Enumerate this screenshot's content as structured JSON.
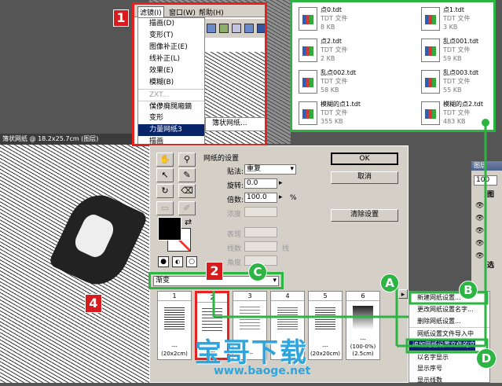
{
  "badges": {
    "one": "1",
    "two": "2",
    "four": "4",
    "a": "A",
    "b": "B",
    "c": "C",
    "d": "D"
  },
  "menubar": {
    "filter": "滤镜(I)",
    "window": "窗口(W)",
    "help": "帮助(H)"
  },
  "filter_menu": {
    "items": [
      "描画(D)",
      "变形(T)",
      "图像补正(E)",
      "线补正(L)",
      "效果(E)",
      "模糊(B)",
      "ZXT...",
      "僕儚廃闊廂鏑",
      "变形",
      "力量网纸3",
      "描画"
    ],
    "submenu": "簿状网纸..."
  },
  "files": [
    {
      "name": "点0.tdt",
      "type": "TDT 文件",
      "size": "8 KB"
    },
    {
      "name": "点1.tdt",
      "type": "TDT 文件",
      "size": "3 KB"
    },
    {
      "name": "点2.tdt",
      "type": "TDT 文件",
      "size": "2 KB"
    },
    {
      "name": "乱点001.tdt",
      "type": "TDT 文件",
      "size": "59 KB"
    },
    {
      "name": "乱点002.tdt",
      "type": "TDT 文件",
      "size": "58 KB"
    },
    {
      "name": "乱点003.tdt",
      "type": "TDT 文件",
      "size": "55 KB"
    },
    {
      "name": "模糊的点1.tdt",
      "type": "TDT 文件",
      "size": "355 KB"
    },
    {
      "name": "模糊的点2.tdt",
      "type": "TDT 文件",
      "size": "483 KB"
    }
  ],
  "doc_title": "簿状网纸 @ 18.2x25.7cm (图层)",
  "dialog": {
    "group_title": "网纸的设置",
    "paste_label": "贴法:",
    "paste_value": "重复",
    "rotate_label": "旋转:",
    "rotate_value": "0.0",
    "scale_label": "倍数:",
    "scale_value": "100.0",
    "scale_unit": "%",
    "density_label": "浓度",
    "expr_label": "表现",
    "lines_label": "线数",
    "lines_unit": "线",
    "angle_label": "角度",
    "ok": "OK",
    "cancel": "取消",
    "clear": "清除设置",
    "preset_value": "渐变",
    "swatch_numbers": [
      "1",
      "2",
      "3",
      "4",
      "5",
      "6"
    ],
    "swatch_labels": [
      "---",
      "---",
      "---",
      "---",
      "---",
      "---"
    ],
    "swatch_sub": [
      "(20x2cm)",
      "",
      "",
      "",
      "(20x20cm)",
      "(100-0%)"
    ],
    "swatch_sub2": [
      "",
      "",
      "",
      "",
      "",
      "(2.5cm)"
    ]
  },
  "context_menu": {
    "items": [
      "新建网纸设置...",
      "更改网纸设置名字...",
      "删除网纸设置...",
      "网纸设置文件导入中",
      "追加网纸设置文件的文件",
      "以名字显示",
      "显示序号",
      "显示线数"
    ]
  },
  "layers_panel": {
    "title": "图层",
    "value": "100",
    "label1": "图",
    "label2": "选"
  },
  "watermark": {
    "title": "宝哥下载",
    "url": "www.baoge.net"
  },
  "colors": {
    "red": "#e8201f",
    "green": "#2db544"
  }
}
